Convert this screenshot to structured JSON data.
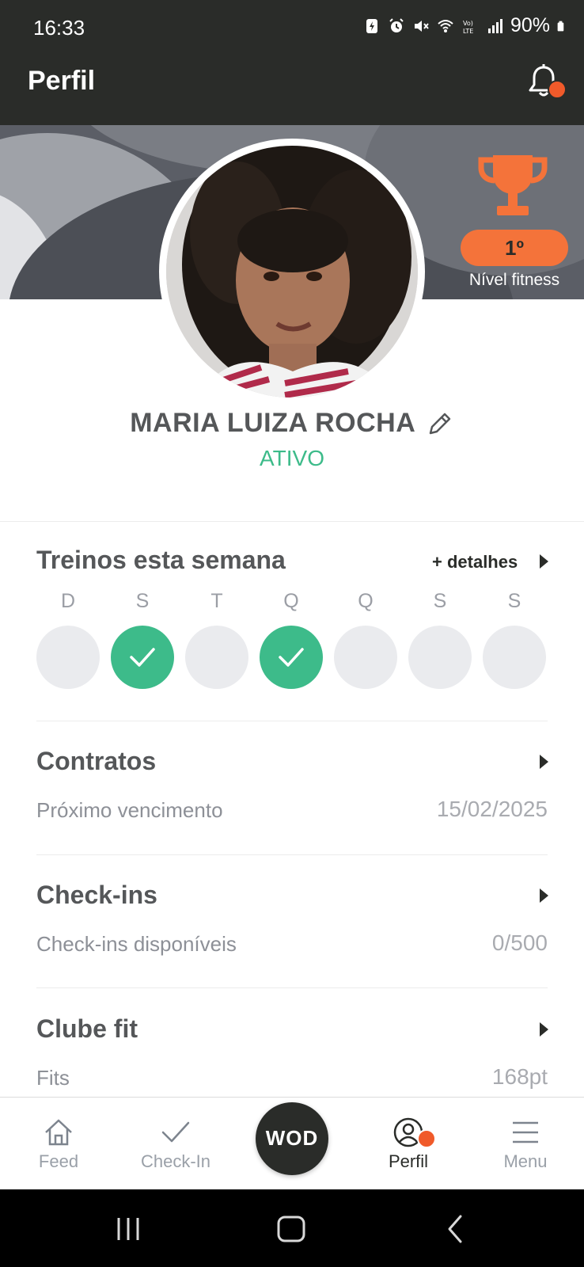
{
  "status_bar": {
    "time": "16:33",
    "battery": "90%",
    "icons": [
      "battery-saver-icon",
      "alarm-icon",
      "mute-icon",
      "wifi-icon",
      "volte-icon",
      "signal-icon",
      "battery-icon"
    ]
  },
  "app_bar": {
    "title": "Perfil",
    "notification_icon": "bell-icon"
  },
  "profile": {
    "name": "MARIA LUIZA ROCHA",
    "status": "ATIVO",
    "edit_icon": "pencil-icon",
    "level_rank": "1º",
    "level_label": "Nível fitness"
  },
  "week": {
    "title": "Treinos esta semana",
    "details_label": "+ detalhes",
    "days": [
      {
        "letter": "D",
        "done": false
      },
      {
        "letter": "S",
        "done": true
      },
      {
        "letter": "T",
        "done": false
      },
      {
        "letter": "Q",
        "done": true
      },
      {
        "letter": "Q",
        "done": false
      },
      {
        "letter": "S",
        "done": false
      },
      {
        "letter": "S",
        "done": false
      }
    ]
  },
  "contracts": {
    "title": "Contratos",
    "label": "Próximo vencimento",
    "value": "15/02/2025"
  },
  "checkins": {
    "title": "Check-ins",
    "label": "Check-ins disponíveis",
    "value": "0/500"
  },
  "club": {
    "title": "Clube fit",
    "label": "Fits",
    "value": "168pt"
  },
  "tabbar": {
    "feed": "Feed",
    "checkin": "Check-In",
    "wod": "WOD",
    "perfil": "Perfil",
    "menu": "Menu"
  },
  "colors": {
    "header": "#2a2c29",
    "accent_green": "#3dbb8a",
    "accent_orange": "#f4733a",
    "notification_dot": "#f05a2a"
  }
}
